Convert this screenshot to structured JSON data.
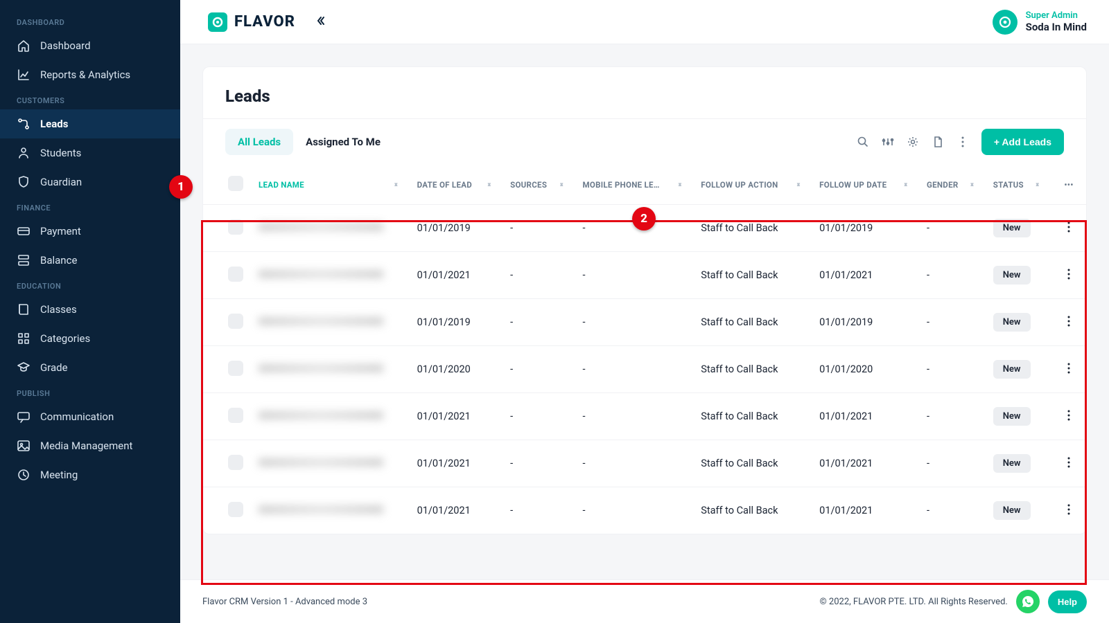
{
  "brand": "FLAVOR",
  "user": {
    "role": "Super Admin",
    "name": "Soda In Mind"
  },
  "sidebar": {
    "sections": [
      {
        "title": "DASHBOARD",
        "items": [
          {
            "label": "Dashboard",
            "icon": "home"
          },
          {
            "label": "Reports & Analytics",
            "icon": "chart"
          }
        ]
      },
      {
        "title": "CUSTOMERS",
        "items": [
          {
            "label": "Leads",
            "icon": "flow",
            "active": true
          },
          {
            "label": "Students",
            "icon": "user"
          },
          {
            "label": "Guardian",
            "icon": "shield"
          }
        ]
      },
      {
        "title": "FINANCE",
        "items": [
          {
            "label": "Payment",
            "icon": "card"
          },
          {
            "label": "Balance",
            "icon": "stack"
          }
        ]
      },
      {
        "title": "EDUCATION",
        "items": [
          {
            "label": "Classes",
            "icon": "book"
          },
          {
            "label": "Categories",
            "icon": "grid"
          },
          {
            "label": "Grade",
            "icon": "grad"
          }
        ]
      },
      {
        "title": "PUBLISH",
        "items": [
          {
            "label": "Communication",
            "icon": "chat"
          },
          {
            "label": "Media Management",
            "icon": "image"
          },
          {
            "label": "Meeting",
            "icon": "meet"
          }
        ]
      }
    ]
  },
  "page": {
    "title": "Leads",
    "tabs": [
      "All Leads",
      "Assigned To Me"
    ],
    "activeTab": 0,
    "addButton": "+ Add Leads"
  },
  "table": {
    "columns": [
      "LEAD NAME",
      "DATE OF LEAD",
      "SOURCES",
      "MOBILE PHONE LE…",
      "FOLLOW UP ACTION",
      "FOLLOW UP DATE",
      "GENDER",
      "STATUS"
    ],
    "rows": [
      {
        "date": "01/01/2019",
        "sources": "-",
        "phone": "-",
        "action": "Staff to Call Back",
        "fdate": "01/01/2019",
        "gender": "-",
        "status": "New"
      },
      {
        "date": "01/01/2021",
        "sources": "-",
        "phone": "-",
        "action": "Staff to Call Back",
        "fdate": "01/01/2021",
        "gender": "-",
        "status": "New"
      },
      {
        "date": "01/01/2019",
        "sources": "-",
        "phone": "-",
        "action": "Staff to Call Back",
        "fdate": "01/01/2019",
        "gender": "-",
        "status": "New"
      },
      {
        "date": "01/01/2020",
        "sources": "-",
        "phone": "-",
        "action": "Staff to Call Back",
        "fdate": "01/01/2020",
        "gender": "-",
        "status": "New"
      },
      {
        "date": "01/01/2021",
        "sources": "-",
        "phone": "-",
        "action": "Staff to Call Back",
        "fdate": "01/01/2021",
        "gender": "-",
        "status": "New"
      },
      {
        "date": "01/01/2021",
        "sources": "-",
        "phone": "-",
        "action": "Staff to Call Back",
        "fdate": "01/01/2021",
        "gender": "-",
        "status": "New"
      },
      {
        "date": "01/01/2021",
        "sources": "-",
        "phone": "-",
        "action": "Staff to Call Back",
        "fdate": "01/01/2021",
        "gender": "-",
        "status": "New"
      }
    ]
  },
  "footer": {
    "version": "Flavor CRM Version 1 - Advanced mode 3",
    "copyright": "© 2022, FLAVOR PTE. LTD. All Rights Reserved.",
    "help": "Help"
  },
  "callouts": {
    "c1": "1",
    "c2": "2"
  }
}
